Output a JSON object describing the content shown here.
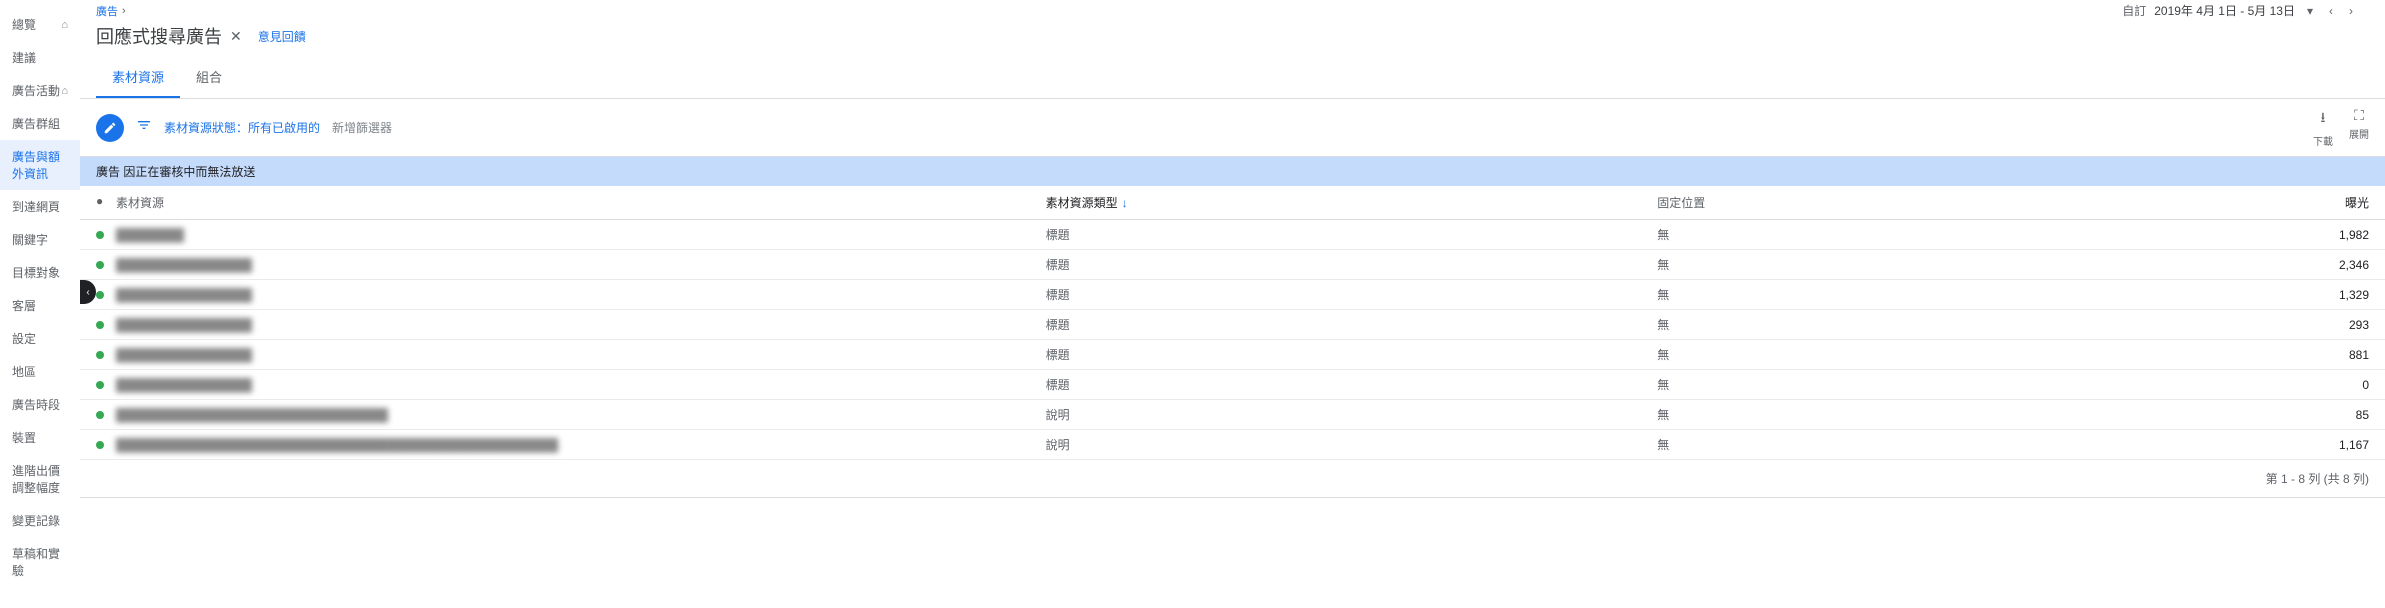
{
  "sidebar": {
    "items": [
      {
        "label": "總覽",
        "has_home": true
      },
      {
        "label": "建議"
      },
      {
        "label": "廣告活動",
        "has_home": true
      },
      {
        "label": "廣告群組"
      },
      {
        "label": "廣告與額外資訊",
        "active": true
      },
      {
        "label": "到達網頁"
      },
      {
        "label": "關鍵字"
      },
      {
        "label": "目標對象"
      },
      {
        "label": "客層"
      },
      {
        "label": "設定"
      },
      {
        "label": "地區"
      },
      {
        "label": "廣告時段"
      },
      {
        "label": "裝置"
      },
      {
        "label": "進階出價調整幅度"
      },
      {
        "label": "變更記錄"
      },
      {
        "label": "草稿和實驗"
      }
    ]
  },
  "breadcrumb": {
    "parent": "廣告"
  },
  "header": {
    "title": "回應式搜尋廣告",
    "feedback_link": "意見回饋",
    "date_label": "自訂",
    "date_range": "2019年 4月 1日 - 5月 13日"
  },
  "tabs": [
    {
      "label": "素材資源",
      "active": true
    },
    {
      "label": "組合"
    }
  ],
  "toolbar": {
    "filter_chip_label": "素材資源狀態：",
    "filter_chip_value": "所有已啟用的",
    "add_filter": "新增篩選器",
    "download_label": "下載",
    "expand_label": "展開"
  },
  "notice": "廣告 因正在審核中而無法放送",
  "columns": {
    "asset": "素材資源",
    "type": "素材資源類型",
    "position": "固定位置",
    "impressions": "曝光"
  },
  "rows": [
    {
      "asset": "████████",
      "type": "標題",
      "position": "無",
      "impressions": "1,982"
    },
    {
      "asset": "████████████████",
      "type": "標題",
      "position": "無",
      "impressions": "2,346"
    },
    {
      "asset": "████████████████",
      "type": "標題",
      "position": "無",
      "impressions": "1,329"
    },
    {
      "asset": "████████████████",
      "type": "標題",
      "position": "無",
      "impressions": "293"
    },
    {
      "asset": "████████████████",
      "type": "標題",
      "position": "無",
      "impressions": "881"
    },
    {
      "asset": "████████████████",
      "type": "標題",
      "position": "無",
      "impressions": "0"
    },
    {
      "asset": "████████████████████████████████",
      "type": "說明",
      "position": "無",
      "impressions": "85"
    },
    {
      "asset": "████████████████████████████████████████████████████",
      "type": "說明",
      "position": "無",
      "impressions": "1,167"
    }
  ],
  "footer": {
    "pagination": "第 1 - 8 列 (共 8 列)"
  }
}
